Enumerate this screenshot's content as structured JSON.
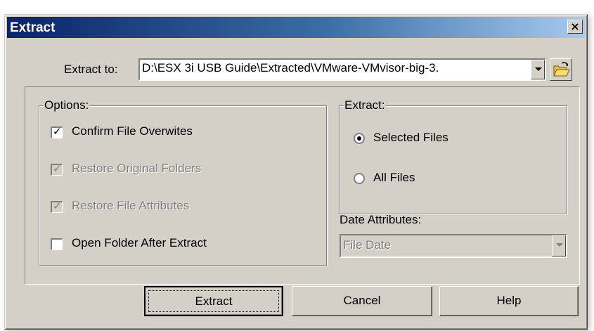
{
  "window": {
    "title": "Extract",
    "close_glyph": "×"
  },
  "extract_to": {
    "label": "Extract to:",
    "value": "D:\\ESX 3i USB Guide\\Extracted\\VMware-VMvisor-big-3.",
    "browse_icon": "open-folder-icon"
  },
  "options": {
    "title": "Options:",
    "items": [
      {
        "label": "Confirm File Overwites",
        "checked": true,
        "enabled": true
      },
      {
        "label": "Restore Original Folders",
        "checked": true,
        "enabled": false
      },
      {
        "label": "Restore File Attributes",
        "checked": true,
        "enabled": false
      },
      {
        "label": "Open Folder After Extract",
        "checked": false,
        "enabled": true
      }
    ]
  },
  "extract_group": {
    "title": "Extract:",
    "options": [
      {
        "label": "Selected Files",
        "selected": true
      },
      {
        "label": "All Files",
        "selected": false
      }
    ]
  },
  "date_attributes": {
    "label": "Date Attributes:",
    "value": "File Date",
    "enabled": false
  },
  "buttons": {
    "extract": "Extract",
    "cancel": "Cancel",
    "help": "Help"
  },
  "colors": {
    "title_gradient_start": "#0a246a",
    "title_gradient_end": "#a6caf0",
    "face": "#d4d0c8",
    "disabled_text": "#808080"
  }
}
